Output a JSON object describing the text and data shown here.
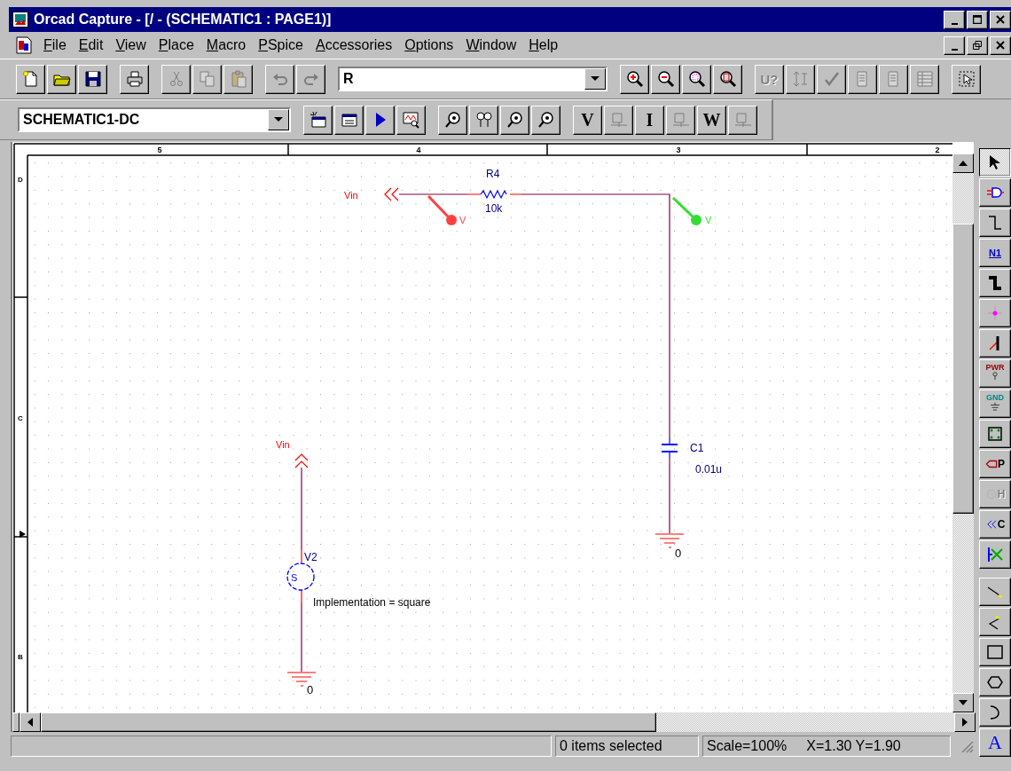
{
  "window": {
    "title": "Orcad Capture - [/ - (SCHEMATIC1 : PAGE1)]"
  },
  "menu": [
    "File",
    "Edit",
    "View",
    "Place",
    "Macro",
    "PSpice",
    "Accessories",
    "Options",
    "Window",
    "Help"
  ],
  "toolbar_1": [
    {
      "kind": "group",
      "buttons": [
        {
          "disabled": false
        },
        {
          "disabled": false
        },
        {
          "disabled": false
        }
      ]
    },
    {
      "kind": "group",
      "buttons": [
        {
          "disabled": false
        }
      ]
    },
    {
      "kind": "group",
      "buttons": [
        {
          "disabled": true
        },
        {
          "disabled": true
        },
        {
          "disabled": true
        }
      ]
    },
    {
      "kind": "group",
      "buttons": [
        {
          "disabled": true
        },
        {
          "disabled": true
        }
      ]
    },
    {
      "kind": "combo",
      "value": "R"
    },
    {
      "kind": "group",
      "buttons": [
        {
          "disabled": false
        },
        {
          "disabled": false
        },
        {
          "disabled": false
        },
        {
          "disabled": false
        }
      ]
    },
    {
      "kind": "group",
      "buttons": [
        {
          "label": "U?",
          "disabled": true
        },
        {
          "disabled": true
        },
        {
          "disabled": true
        },
        {
          "disabled": true
        },
        {
          "disabled": true
        },
        {
          "disabled": true
        }
      ]
    },
    {
      "kind": "group",
      "buttons": [
        {
          "disabled": false
        }
      ]
    }
  ],
  "toolbar_2": [
    {
      "kind": "combo",
      "value": "SCHEMATIC1-DC"
    },
    {
      "kind": "group",
      "buttons": [
        {
          "disabled": false
        },
        {
          "disabled": false
        },
        {
          "disabled": false
        },
        {
          "disabled": false
        }
      ]
    },
    {
      "kind": "group",
      "buttons": [
        {
          "disabled": false
        },
        {
          "disabled": false
        },
        {
          "disabled": false
        },
        {
          "disabled": false
        }
      ]
    },
    {
      "kind": "group",
      "buttons": [
        {
          "label": "V",
          "disabled": false
        },
        {
          "disabled": true
        },
        {
          "label": "I",
          "disabled": false
        },
        {
          "disabled": true
        },
        {
          "label": "W",
          "disabled": false
        },
        {
          "disabled": true
        }
      ]
    }
  ],
  "palette": [
    {
      "selected": true,
      "disabled": false
    },
    {
      "selected": false,
      "disabled": false
    },
    {
      "selected": false,
      "disabled": false
    },
    {
      "label": "N1",
      "selected": false,
      "disabled": false
    },
    {
      "selected": false,
      "disabled": false
    },
    {
      "selected": false,
      "disabled": false
    },
    {
      "selected": false,
      "disabled": false
    },
    {
      "label": "PWR",
      "selected": false,
      "disabled": false
    },
    {
      "label": "GND",
      "selected": false,
      "disabled": false
    },
    {
      "selected": false,
      "disabled": false
    },
    {
      "label": "P",
      "selected": false,
      "disabled": false
    },
    {
      "label": "H",
      "selected": false,
      "disabled": true
    },
    {
      "label": "C",
      "selected": false,
      "disabled": false
    },
    {
      "selected": false,
      "disabled": false
    },
    {
      "selected": false,
      "disabled": false
    },
    {
      "selected": false,
      "disabled": false
    },
    {
      "selected": false,
      "disabled": false
    },
    {
      "selected": false,
      "disabled": false
    },
    {
      "selected": false,
      "disabled": false
    },
    {
      "label": "A",
      "selected": false,
      "disabled": false
    }
  ],
  "schematic": {
    "border_columns": [
      "5",
      "4",
      "3",
      "2"
    ],
    "border_rows": [
      "D",
      "C",
      "B"
    ],
    "offpage_connectors": [
      {
        "label": "Vin"
      },
      {
        "label": "Vin"
      }
    ],
    "resistor": {
      "reference": "R4",
      "value": "10k"
    },
    "capacitor": {
      "reference": "C1",
      "value": "0.01u"
    },
    "source": {
      "reference": "V2",
      "symbol": "S",
      "property": "Implementation = square"
    },
    "grounds": [
      {
        "label": "0"
      },
      {
        "label": "0"
      }
    ],
    "markers": [
      {
        "label": "V",
        "color": "#ff4040"
      },
      {
        "label": "V",
        "color": "#33dd33"
      }
    ]
  },
  "status_bar": {
    "selection": "0 items selected",
    "scale": "Scale=100%",
    "coordinates": "X=1.30 Y=1.90"
  }
}
